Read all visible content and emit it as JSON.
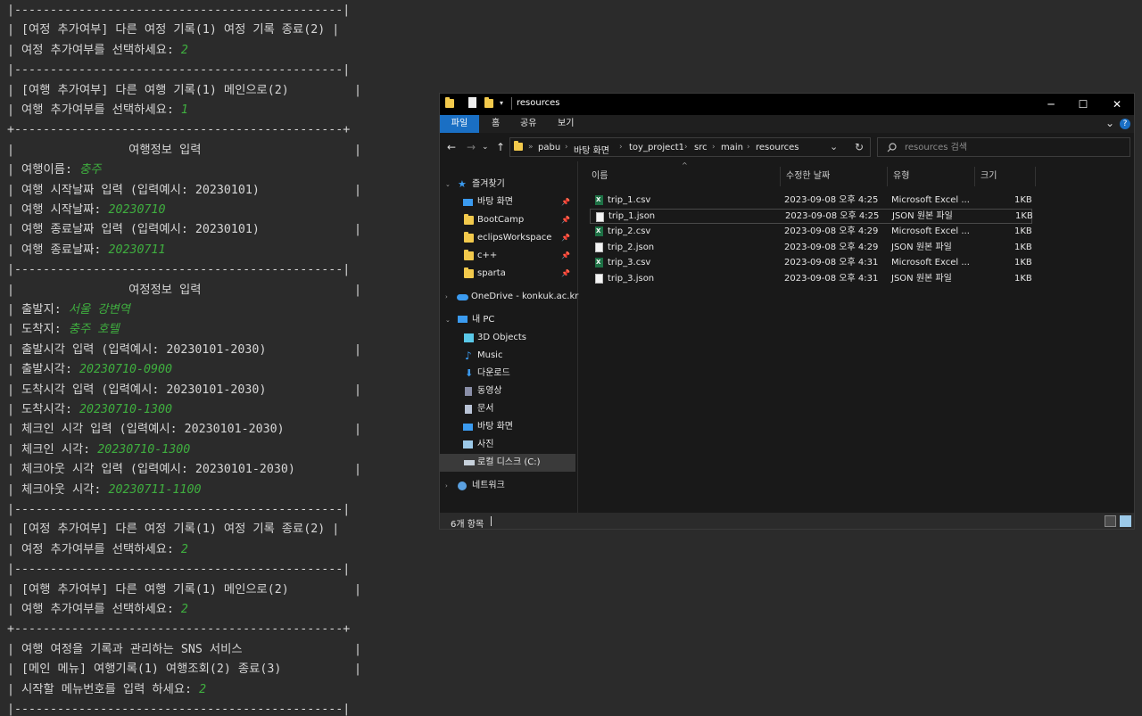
{
  "console": {
    "lines": [
      {
        "t": "|----------------------------------------------|"
      },
      {
        "t": "| [여정 추가여부] 다른 여정 기록(1) 여정 기록 종료(2) |"
      },
      {
        "t": "| 여정 추가여부를 선택하세요: ",
        "in": "2"
      },
      {
        "t": "|----------------------------------------------|"
      },
      {
        "t": "| [여행 추가여부] 다른 여행 기록(1) 메인으로(2)",
        "end": "|"
      },
      {
        "t": "| 여행 추가여부를 선택하세요: ",
        "in": "1"
      },
      {
        "t": "+----------------------------------------------+"
      },
      {
        "t": "|                여행정보 입력",
        "end": "|"
      },
      {
        "t": "| 여행이름: ",
        "in": "충주"
      },
      {
        "t": "| 여행 시작날짜 입력 (입력예시: 20230101)",
        "end": "|"
      },
      {
        "t": "| 여행 시작날짜: ",
        "in": "20230710"
      },
      {
        "t": "| 여행 종료날짜 입력 (입력예시: 20230101)",
        "end": "|"
      },
      {
        "t": "| 여행 종료날짜: ",
        "in": "20230711"
      },
      {
        "t": "|----------------------------------------------|"
      },
      {
        "t": "|                여정정보 입력",
        "end": "|"
      },
      {
        "t": "| 출발지: ",
        "in": "서울 강변역"
      },
      {
        "t": "| 도착지: ",
        "in": "충주 호텔"
      },
      {
        "t": "| 출발시각 입력 (입력예시: 20230101-2030)",
        "end": "|"
      },
      {
        "t": "| 출발시각: ",
        "in": "20230710-0900"
      },
      {
        "t": "| 도착시각 입력 (입력예시: 20230101-2030)",
        "end": "|"
      },
      {
        "t": "| 도착시각: ",
        "in": "20230710-1300"
      },
      {
        "t": "| 체크인 시각 입력 (입력예시: 20230101-2030)",
        "end": "|"
      },
      {
        "t": "| 체크인 시각: ",
        "in": "20230710-1300"
      },
      {
        "t": "| 체크아웃 시각 입력 (입력예시: 20230101-2030)",
        "end": "|"
      },
      {
        "t": "| 체크아웃 시각: ",
        "in": "20230711-1100"
      },
      {
        "t": "|----------------------------------------------|"
      },
      {
        "t": "| [여정 추가여부] 다른 여정 기록(1) 여정 기록 종료(2) |"
      },
      {
        "t": "| 여정 추가여부를 선택하세요: ",
        "in": "2"
      },
      {
        "t": "|----------------------------------------------|"
      },
      {
        "t": "| [여행 추가여부] 다른 여행 기록(1) 메인으로(2)",
        "end": "|"
      },
      {
        "t": "| 여행 추가여부를 선택하세요: ",
        "in": "2"
      },
      {
        "t": "+----------------------------------------------+"
      },
      {
        "t": "| 여행 여정을 기록과 관리하는 SNS 서비스",
        "end": "|"
      },
      {
        "t": "| [메인 메뉴] 여행기록(1) 여행조회(2) 종료(3)",
        "end": "|"
      },
      {
        "t": "| 시작할 메뉴번호를 입력 하세요: ",
        "in": "2"
      },
      {
        "t": "|----------------------------------------------|"
      }
    ]
  },
  "explorer": {
    "title": "resources",
    "window_controls": {
      "minimize": "─",
      "maximize": "☐",
      "close": "✕"
    },
    "ribbon": {
      "tabs": [
        "파일",
        "홈",
        "공유",
        "보기"
      ],
      "help": "?",
      "collapse": "⌄"
    },
    "nav": {
      "back": "←",
      "forward": "→",
      "recent": "⌄",
      "up": "↑",
      "refresh": "↻",
      "dropdown": "⌄"
    },
    "breadcrumb": [
      "pabu",
      "바탕 화면",
      "toy_project1",
      "src",
      "main",
      "resources"
    ],
    "search": {
      "placeholder": "resources 검색"
    },
    "sidebar": [
      {
        "label": "즐겨찾기",
        "icon": "star-icon"
      },
      {
        "label": "바탕 화면",
        "icon": "desktop-icon",
        "pinned": true
      },
      {
        "label": "BootCamp",
        "icon": "folder-icon",
        "pinned": true
      },
      {
        "label": "eclipsWorkspace",
        "icon": "folder-icon",
        "pinned": true
      },
      {
        "label": "c++",
        "icon": "folder-icon",
        "pinned": true
      },
      {
        "label": "sparta",
        "icon": "folder-icon",
        "pinned": true
      },
      {
        "label": "OneDrive - konkuk.ac.kr",
        "icon": "cloud-icon"
      },
      {
        "label": "내 PC",
        "icon": "pc-icon"
      },
      {
        "label": "3D Objects",
        "icon": "cube-icon"
      },
      {
        "label": "Music",
        "icon": "music-icon"
      },
      {
        "label": "다운로드",
        "icon": "download-icon"
      },
      {
        "label": "동영상",
        "icon": "video-icon"
      },
      {
        "label": "문서",
        "icon": "document-icon"
      },
      {
        "label": "바탕 화면",
        "icon": "desktop-icon"
      },
      {
        "label": "사진",
        "icon": "picture-icon"
      },
      {
        "label": "로컬 디스크 (C:)",
        "icon": "drive-icon",
        "selected": true
      },
      {
        "label": "네트워크",
        "icon": "network-icon"
      }
    ],
    "pin_glyph": "📌",
    "columns": [
      "이름",
      "수정한 날짜",
      "유형",
      "크기"
    ],
    "sort_indicator": "^",
    "files": [
      {
        "name": "trip_1.csv",
        "date": "2023-09-08 오후 4:25",
        "type": "Microsoft Excel ...",
        "size": "1KB",
        "icon": "excel-csv-icon"
      },
      {
        "name": "trip_1.json",
        "date": "2023-09-08 오후 4:25",
        "type": "JSON 원본 파일",
        "size": "1KB",
        "icon": "json-file-icon",
        "highlighted": true
      },
      {
        "name": "trip_2.csv",
        "date": "2023-09-08 오후 4:29",
        "type": "Microsoft Excel ...",
        "size": "1KB",
        "icon": "excel-csv-icon"
      },
      {
        "name": "trip_2.json",
        "date": "2023-09-08 오후 4:29",
        "type": "JSON 원본 파일",
        "size": "1KB",
        "icon": "json-file-icon"
      },
      {
        "name": "trip_3.csv",
        "date": "2023-09-08 오후 4:31",
        "type": "Microsoft Excel ...",
        "size": "1KB",
        "icon": "excel-csv-icon"
      },
      {
        "name": "trip_3.json",
        "date": "2023-09-08 오후 4:31",
        "type": "JSON 원본 파일",
        "size": "1KB",
        "icon": "json-file-icon"
      }
    ],
    "status": {
      "count": "6개 항목"
    },
    "colors": {
      "accent": "#1a6fc4",
      "input_text": "#3fae3f",
      "excel": "#1e7145",
      "folder": "#f2c94c"
    }
  }
}
